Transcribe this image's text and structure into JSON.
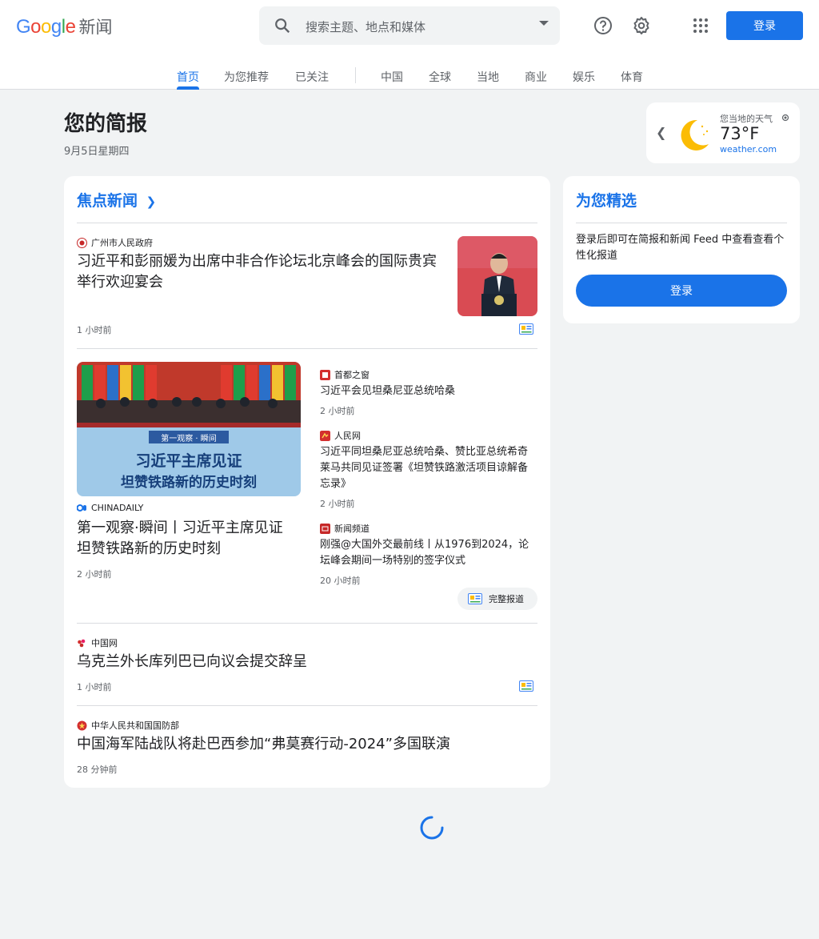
{
  "header": {
    "logo": {
      "letters": [
        "G",
        "o",
        "o",
        "g",
        "l",
        "e"
      ],
      "colors": [
        "#4285f4",
        "#ea4335",
        "#fbbc05",
        "#4285f4",
        "#34a853",
        "#ea4335"
      ],
      "brand": "新闻"
    },
    "search": {
      "placeholder": "搜索主题、地点和媒体",
      "icon": "search-icon"
    },
    "icons": [
      "help-icon",
      "settings-icon",
      "apps-icon"
    ],
    "signin_label": "登录"
  },
  "tabs": [
    {
      "label": "首页",
      "active": true
    },
    {
      "label": "为您推荐"
    },
    {
      "label": "已关注"
    },
    {
      "label": "中国"
    },
    {
      "label": "全球"
    },
    {
      "label": "当地"
    },
    {
      "label": "商业"
    },
    {
      "label": "娱乐"
    },
    {
      "label": "体育"
    }
  ],
  "briefing": {
    "title": "您的简报",
    "date": "9月5日星期四"
  },
  "weather": {
    "label": "您当地的天气",
    "temp": "73°F",
    "source": "weather.com",
    "icon": "moon-icon"
  },
  "top_stories": {
    "title": "焦点新闻",
    "items": [
      {
        "source": "广州市人民政府",
        "headline": "习近平和彭丽媛为出席中非合作论坛北京峰会的国际贵宾举行欢迎宴会",
        "time": "1 小时前"
      },
      {
        "source": "CHINADAILY",
        "headline": "第一观察·瞬间丨习近平主席见证坦赞铁路新的历史时刻",
        "time": "2 小时前",
        "image_text": {
          "banner": "第一观察 · 瞬间",
          "line1": "习近平主席见证",
          "line2": "坦赞铁路新的历史时刻"
        },
        "related": [
          {
            "source": "首都之窗",
            "headline": "习近平会见坦桑尼亚总统哈桑",
            "time": "2 小时前"
          },
          {
            "source": "人民网",
            "headline": "习近平同坦桑尼亚总统哈桑、赞比亚总统希奇莱马共同见证签署《坦赞铁路激活项目谅解备忘录》",
            "time": "2 小时前"
          },
          {
            "source": "新闻频道",
            "headline": "刚强@大国外交最前线丨从1976到2024，论坛峰会期间一场特别的签字仪式",
            "time": "20 小时前"
          }
        ],
        "full_coverage": "完整报道"
      },
      {
        "source": "中国网",
        "headline": "乌克兰外长库列巴已向议会提交辞呈",
        "time": "1 小时前"
      },
      {
        "source": "中华人民共和国国防部",
        "headline": "中国海军陆战队将赴巴西参加“弗莫赛行动-2024”多国联演",
        "time": "28 分钟前"
      }
    ]
  },
  "for_you": {
    "title": "为您精选",
    "text": "登录后即可在简报和新闻 Feed 中查看查看个性化报道",
    "button": "登录"
  },
  "colors": {
    "accent": "#1a73e8",
    "background": "#f1f3f4",
    "moon": "#fbbc04"
  }
}
